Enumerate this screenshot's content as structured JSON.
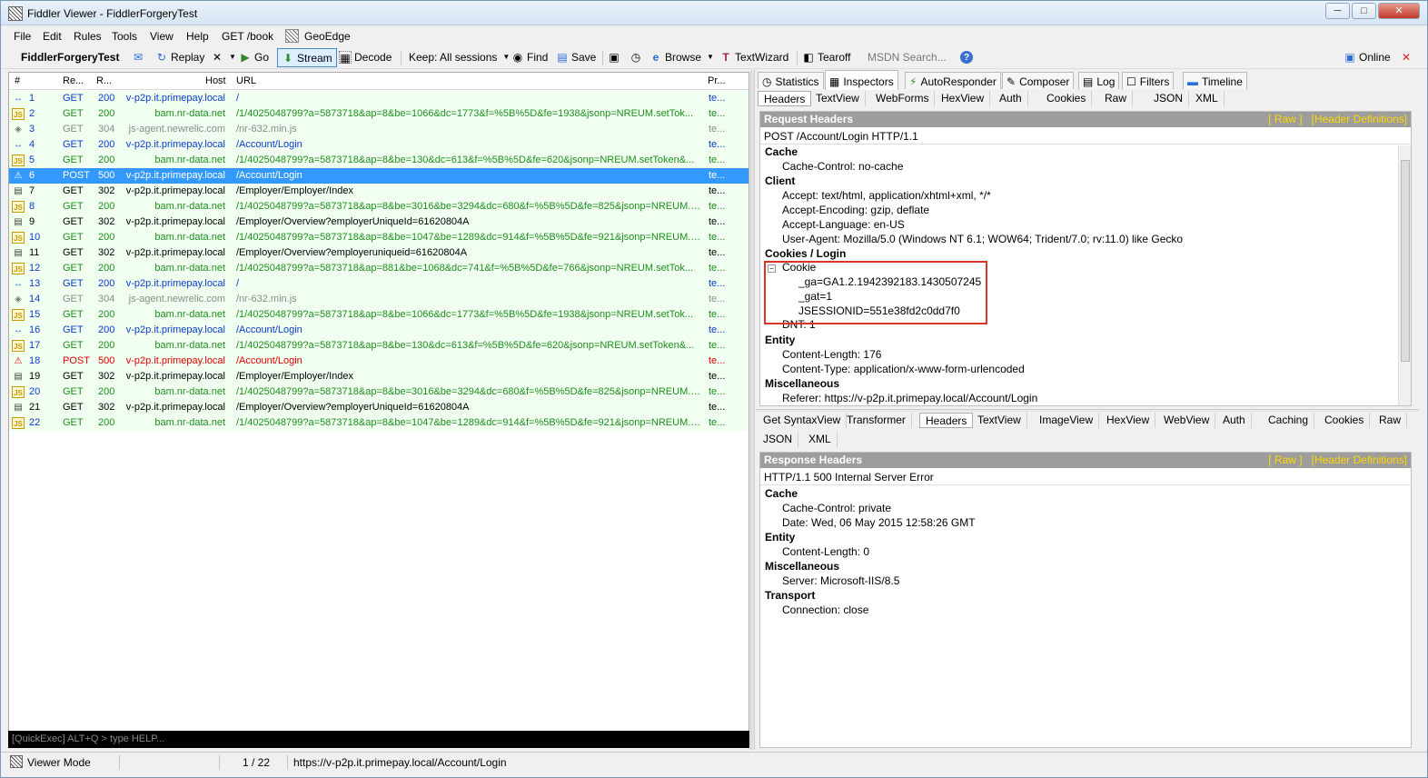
{
  "window": {
    "title": "Fiddler Viewer - FiddlerForgeryTest",
    "min": "─",
    "max": "□",
    "close": "✕"
  },
  "menu": [
    "File",
    "Edit",
    "Rules",
    "Tools",
    "View",
    "Help",
    "GET /book",
    "GeoEdge"
  ],
  "toolbar": {
    "session_name": "FiddlerForgeryTest",
    "replay": "Replay",
    "go": "Go",
    "stream": "Stream",
    "decode": "Decode",
    "keep": "Keep: All sessions",
    "find": "Find",
    "save": "Save",
    "browse": "Browse",
    "textwizard": "TextWizard",
    "tearoff": "Tearoff",
    "msdn": "MSDN Search...",
    "online": "Online",
    "close": "✕"
  },
  "grid": {
    "columns": [
      "#",
      "Re...",
      "R...",
      "Host",
      "URL",
      "Pr..."
    ],
    "rows": [
      {
        "icon": "arrows",
        "num": "1",
        "result": "GET",
        "code": "200",
        "host": "v-p2p.it.primepay.local",
        "url": "/",
        "proto": "te...",
        "color": "blue"
      },
      {
        "icon": "js",
        "num": "2",
        "result": "GET",
        "code": "200",
        "host": "bam.nr-data.net",
        "url": "/1/4025048799?a=5873718&ap=8&be=1066&dc=1773&f=%5B%5D&fe=1938&jsonp=NREUM.setTok...",
        "proto": "te...",
        "color": "green"
      },
      {
        "icon": "diamond",
        "num": "3",
        "result": "GET",
        "code": "304",
        "host": "js-agent.newrelic.com",
        "url": "/nr-632.min.js",
        "proto": "te...",
        "color": "gray"
      },
      {
        "icon": "arrows",
        "num": "4",
        "result": "GET",
        "code": "200",
        "host": "v-p2p.it.primepay.local",
        "url": "/Account/Login",
        "proto": "te...",
        "color": "blue"
      },
      {
        "icon": "js",
        "num": "5",
        "result": "GET",
        "code": "200",
        "host": "bam.nr-data.net",
        "url": "/1/4025048799?a=5873718&ap=8&be=130&dc=613&f=%5B%5D&fe=620&jsonp=NREUM.setToken&...",
        "proto": "te...",
        "color": "green"
      },
      {
        "icon": "warn",
        "num": "6",
        "result": "POST",
        "code": "500",
        "host": "v-p2p.it.primepay.local",
        "url": "/Account/Login",
        "proto": "te...",
        "color": "red",
        "selected": true
      },
      {
        "icon": "page",
        "num": "7",
        "result": "GET",
        "code": "302",
        "host": "v-p2p.it.primepay.local",
        "url": "/Employer/Employer/Index",
        "proto": "te...",
        "color": "black"
      },
      {
        "icon": "js",
        "num": "8",
        "result": "GET",
        "code": "200",
        "host": "bam.nr-data.net",
        "url": "/1/4025048799?a=5873718&ap=8&be=3016&be=3294&dc=680&f=%5B%5D&fe=825&jsonp=NREUM.setTo...",
        "proto": "te...",
        "color": "green"
      },
      {
        "icon": "page",
        "num": "9",
        "result": "GET",
        "code": "302",
        "host": "v-p2p.it.primepay.local",
        "url": "/Employer/Overview?employerUniqueId=61620804A",
        "proto": "te...",
        "color": "black"
      },
      {
        "icon": "js",
        "num": "10",
        "result": "GET",
        "code": "200",
        "host": "bam.nr-data.net",
        "url": "/1/4025048799?a=5873718&ap=8&be=1047&be=1289&dc=914&f=%5B%5D&fe=921&jsonp=NREUM.setTo...",
        "proto": "te...",
        "color": "green"
      },
      {
        "icon": "page",
        "num": "11",
        "result": "GET",
        "code": "302",
        "host": "v-p2p.it.primepay.local",
        "url": "/Employer/Overview?employeruniqueid=61620804A",
        "proto": "te...",
        "color": "black"
      },
      {
        "icon": "js",
        "num": "12",
        "result": "GET",
        "code": "200",
        "host": "bam.nr-data.net",
        "url": "/1/4025048799?a=5873718&ap=881&be=1068&dc=741&f=%5B%5D&fe=766&jsonp=NREUM.setTok...",
        "proto": "te...",
        "color": "green"
      },
      {
        "icon": "arrows",
        "num": "13",
        "result": "GET",
        "code": "200",
        "host": "v-p2p.it.primepay.local",
        "url": "/",
        "proto": "te...",
        "color": "blue"
      },
      {
        "icon": "diamond",
        "num": "14",
        "result": "GET",
        "code": "304",
        "host": "js-agent.newrelic.com",
        "url": "/nr-632.min.js",
        "proto": "te...",
        "color": "gray"
      },
      {
        "icon": "js",
        "num": "15",
        "result": "GET",
        "code": "200",
        "host": "bam.nr-data.net",
        "url": "/1/4025048799?a=5873718&ap=8&be=1066&dc=1773&f=%5B%5D&fe=1938&jsonp=NREUM.setTok...",
        "proto": "te...",
        "color": "green"
      },
      {
        "icon": "arrows",
        "num": "16",
        "result": "GET",
        "code": "200",
        "host": "v-p2p.it.primepay.local",
        "url": "/Account/Login",
        "proto": "te...",
        "color": "blue"
      },
      {
        "icon": "js",
        "num": "17",
        "result": "GET",
        "code": "200",
        "host": "bam.nr-data.net",
        "url": "/1/4025048799?a=5873718&ap=8&be=130&dc=613&f=%5B%5D&fe=620&jsonp=NREUM.setToken&...",
        "proto": "te...",
        "color": "green"
      },
      {
        "icon": "warn",
        "num": "18",
        "result": "POST",
        "code": "500",
        "host": "v-p2p.it.primepay.local",
        "url": "/Account/Login",
        "proto": "te...",
        "color": "red"
      },
      {
        "icon": "page",
        "num": "19",
        "result": "GET",
        "code": "302",
        "host": "v-p2p.it.primepay.local",
        "url": "/Employer/Employer/Index",
        "proto": "te...",
        "color": "black"
      },
      {
        "icon": "js",
        "num": "20",
        "result": "GET",
        "code": "200",
        "host": "bam.nr-data.net",
        "url": "/1/4025048799?a=5873718&ap=8&be=3016&be=3294&dc=680&f=%5B%5D&fe=825&jsonp=NREUM.setTo...",
        "proto": "te...",
        "color": "green"
      },
      {
        "icon": "page",
        "num": "21",
        "result": "GET",
        "code": "302",
        "host": "v-p2p.it.primepay.local",
        "url": "/Employer/Overview?employerUniqueId=61620804A",
        "proto": "te...",
        "color": "black"
      },
      {
        "icon": "js",
        "num": "22",
        "result": "GET",
        "code": "200",
        "host": "bam.nr-data.net",
        "url": "/1/4025048799?a=5873718&ap=8&be=1047&be=1289&dc=914&f=%5B%5D&fe=921&jsonp=NREUM.setTo...",
        "proto": "te...",
        "color": "green"
      }
    ]
  },
  "quickexec": {
    "placeholder": "[QuickExec] ALT+Q > type HELP..."
  },
  "right_tabs": [
    "Statistics",
    "Inspectors",
    "AutoResponder",
    "Composer",
    "Log",
    "Filters",
    "Timeline"
  ],
  "request_tabs": [
    "Headers",
    "TextView",
    "WebForms",
    "HexView",
    "Auth",
    "Cookies",
    "Raw",
    "JSON",
    "XML"
  ],
  "request": {
    "title": "Request Headers",
    "raw": "[ Raw ]",
    "defs": "[Header Definitions]",
    "line": "POST /Account/Login HTTP/1.1",
    "cache": "Cache",
    "cache_control": "Cache-Control: no-cache",
    "client": "Client",
    "accept": "Accept: text/html, application/xhtml+xml, */*",
    "accept_encoding": "Accept-Encoding: gzip, deflate",
    "accept_language": "Accept-Language: en-US",
    "user_agent": "User-Agent: Mozilla/5.0 (Windows NT 6.1; WOW64; Trident/7.0; rv:11.0) like Gecko",
    "cookies": "Cookies / Login",
    "cookie": "Cookie",
    "ga": "_ga=GA1.2.1942392183.1430507245",
    "gat": "_gat=1",
    "jsessionid": "JSESSIONID=551e38fd2c0dd7f0",
    "dnt": "DNT: 1",
    "entity": "Entity",
    "content_length": "Content-Length: 176",
    "content_type": "Content-Type: application/x-www-form-urlencoded",
    "misc": "Miscellaneous",
    "referer": "Referer: https://v-p2p.it.primepay.local/Account/Login"
  },
  "response_tabs": [
    "Get SyntaxView",
    "Transformer",
    "Headers",
    "TextView",
    "ImageView",
    "HexView",
    "WebView",
    "Auth",
    "Caching",
    "Cookies",
    "Raw"
  ],
  "response_tabs2": [
    "JSON",
    "XML"
  ],
  "response": {
    "title": "Response Headers",
    "raw": "[ Raw ]",
    "defs": "[Header Definitions]",
    "line": "HTTP/1.1 500 Internal Server Error",
    "cache": "Cache",
    "cache_control": "Cache-Control: private",
    "date": "Date: Wed, 06 May 2015 12:58:26 GMT",
    "entity": "Entity",
    "content_length": "Content-Length: 0",
    "misc": "Miscellaneous",
    "server": "Server: Microsoft-IIS/8.5",
    "transport": "Transport",
    "connection": "Connection: close"
  },
  "status": {
    "mode": "Viewer Mode",
    "count": "1 / 22",
    "url": "https://v-p2p.it.primepay.local/Account/Login"
  }
}
